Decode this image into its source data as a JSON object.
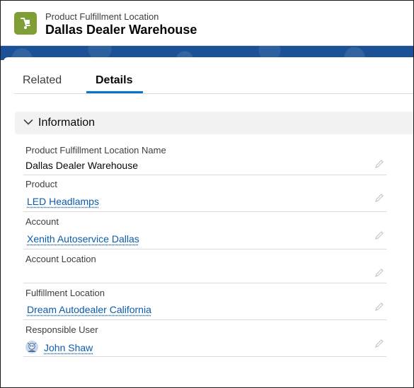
{
  "header": {
    "object_type": "Product Fulfillment Location",
    "record_name": "Dallas Dealer Warehouse",
    "icon": "product-fulfillment-location-icon",
    "icon_color": "#7f9e36"
  },
  "tabs": [
    {
      "label": "Related",
      "active": false
    },
    {
      "label": "Details",
      "active": true
    }
  ],
  "section": {
    "title": "Information",
    "expanded": true
  },
  "fields": {
    "name": {
      "label": "Product Fulfillment Location Name",
      "value": "Dallas Dealer Warehouse"
    },
    "product": {
      "label": "Product",
      "value": "LED Headlamps"
    },
    "account": {
      "label": "Account",
      "value": "Xenith Autoservice Dallas"
    },
    "account_location": {
      "label": "Account Location",
      "value": ""
    },
    "fulfillment_location": {
      "label": "Fulfillment Location",
      "value": "Dream Autodealer California"
    },
    "responsible_user": {
      "label": "Responsible User",
      "value": "John Shaw"
    }
  },
  "colors": {
    "accent": "#0176d3",
    "link": "#0b5cab",
    "band": "#1b5297"
  }
}
